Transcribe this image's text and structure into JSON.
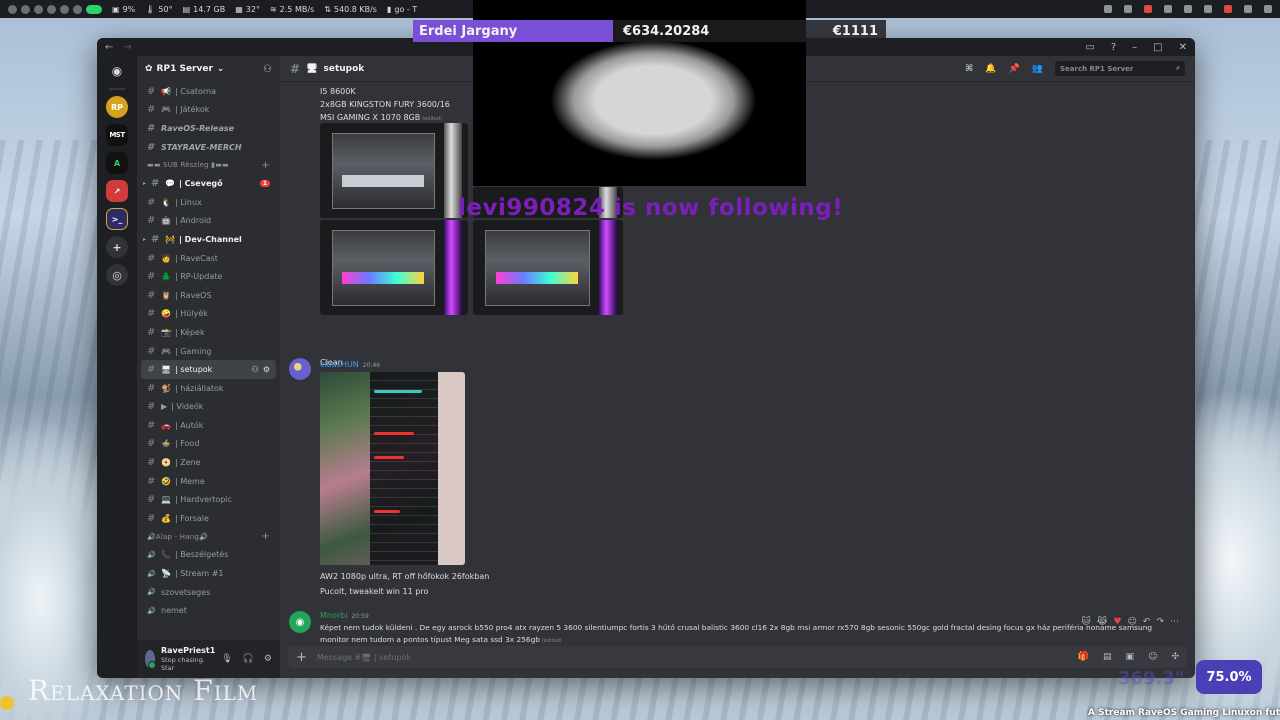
{
  "topbar": {
    "cpu": "9%",
    "temp1": "50°",
    "ram": "14.7 GB",
    "temp2": "32°",
    "net_down": "2.5 MB/s",
    "net_up": "540.8 KB/s",
    "task": "go - T"
  },
  "overlay": {
    "ticker_name": "Erdei Jargany",
    "ticker_price1": "€634.20284",
    "ticker_price2": "€1111",
    "follow_text": "levi990824 is now following!",
    "watermark": "Relaxation Film",
    "zoom": "75.0%",
    "ghost": "369.3\"",
    "bottom_text": "A Stream RaveOS Gaming Linuxon fut"
  },
  "server": {
    "name": "RP1 Server",
    "search_placeholder": "Search RP1 Server"
  },
  "channels": [
    {
      "type": "channel",
      "emoji": "📢",
      "label": "| Csatorna",
      "style": "normal"
    },
    {
      "type": "channel",
      "emoji": "🎮",
      "label": "| Játékok",
      "style": "normal"
    },
    {
      "type": "plain",
      "label": "RaveOS-Release",
      "style": "italic"
    },
    {
      "type": "plain",
      "label": "STAYRAVE-MERCH",
      "style": "italic"
    },
    {
      "type": "category",
      "label": "▬▬ SUB Részleg ▮▬▬"
    },
    {
      "type": "channel",
      "emoji": "💬",
      "label": "| Csevegő",
      "style": "bold",
      "badge": "1",
      "arrow": true
    },
    {
      "type": "channel",
      "emoji": "🐧",
      "label": "| Linux",
      "style": "normal"
    },
    {
      "type": "channel",
      "emoji": "🤖",
      "label": "| Android",
      "style": "normal"
    },
    {
      "type": "channel",
      "emoji": "🚧",
      "label": "| Dev-Channel",
      "style": "bold",
      "arrow": true
    },
    {
      "type": "channel",
      "emoji": "🧑",
      "label": "| RaveCast",
      "style": "normal"
    },
    {
      "type": "channel",
      "emoji": "🌲",
      "label": "| RP-Update",
      "style": "normal"
    },
    {
      "type": "channel",
      "emoji": "🦉",
      "label": "| RaveOS",
      "style": "normal"
    },
    {
      "type": "channel",
      "emoji": "🤪",
      "label": "| Hülyék",
      "style": "normal"
    },
    {
      "type": "channel",
      "emoji": "📸",
      "label": "| Képek",
      "style": "normal"
    },
    {
      "type": "channel",
      "emoji": "🎮",
      "label": "| Gaming",
      "style": "normal"
    },
    {
      "type": "channel",
      "emoji": "🖥",
      "label": "| setupok",
      "style": "active"
    },
    {
      "type": "channel",
      "emoji": "🐒",
      "label": "| háziállatok",
      "style": "normal"
    },
    {
      "type": "channel",
      "emoji": "▶",
      "label": "| Videók",
      "style": "normal"
    },
    {
      "type": "channel",
      "emoji": "🚗",
      "label": "| Autók",
      "style": "normal"
    },
    {
      "type": "channel",
      "emoji": "🍲",
      "label": "| Food",
      "style": "normal"
    },
    {
      "type": "channel",
      "emoji": "📀",
      "label": "| Zene",
      "style": "normal"
    },
    {
      "type": "channel",
      "emoji": "🤣",
      "label": "| Meme",
      "style": "normal"
    },
    {
      "type": "channel",
      "emoji": "💻",
      "label": "| Hardvertopic",
      "style": "normal"
    },
    {
      "type": "channel",
      "emoji": "💰",
      "label": "| Forsale",
      "style": "normal"
    },
    {
      "type": "category",
      "label": "🔊Alap - Hang🔊"
    },
    {
      "type": "voice",
      "emoji": "📞",
      "label": "| Beszélgetés",
      "style": "normal"
    },
    {
      "type": "voice",
      "emoji": "📡",
      "label": "| Stream #1",
      "style": "normal"
    },
    {
      "type": "voice",
      "emoji": "",
      "label": "szovetseges",
      "style": "normal"
    },
    {
      "type": "voice",
      "emoji": "",
      "label": "nemet",
      "style": "normal"
    }
  ],
  "user": {
    "name": "RavePriest1",
    "status": "Stop chasing. Star"
  },
  "channel_header": {
    "name": "setupok",
    "emoji": "🖥"
  },
  "messages": {
    "first_lines": [
      "I5 8600K",
      "2x8GB KINGSTON FURY 3600/16",
      "MSI GAMING X 1070 8GB"
    ],
    "edited": "(edited)",
    "clean": "Clean",
    "cibus": {
      "author": "cibusHUN",
      "time": "20:46",
      "line1": "AW2 1080p ultra, RT off hőfokok 26fokban",
      "line2": "Pucolt, tweakelt win 11 pro"
    },
    "mnorbi": {
      "author": "Mnorbi",
      "time": "20:59",
      "line1": "Képet nem tudok küldeni . De egy asrock b550 pro4 atx rayzen 5 3600 silentiumpc fortis 3 hűtő  crusal balistic 3600 cl16 2x 8gb msi armor rx570 8gb sesonic 550gc gold  fractal desing focus gx ház periféria noname samsung",
      "line2": "monitor nem tudom a pontos típust   Meg sata ssd 3x 256gb"
    }
  },
  "composer": {
    "placeholder": "Message #🖥 | setupok"
  },
  "colors": {
    "accent": "#5865f2",
    "online": "#23a55a",
    "mention": "#f23f43",
    "overlay_purple": "#7a4fd6"
  }
}
